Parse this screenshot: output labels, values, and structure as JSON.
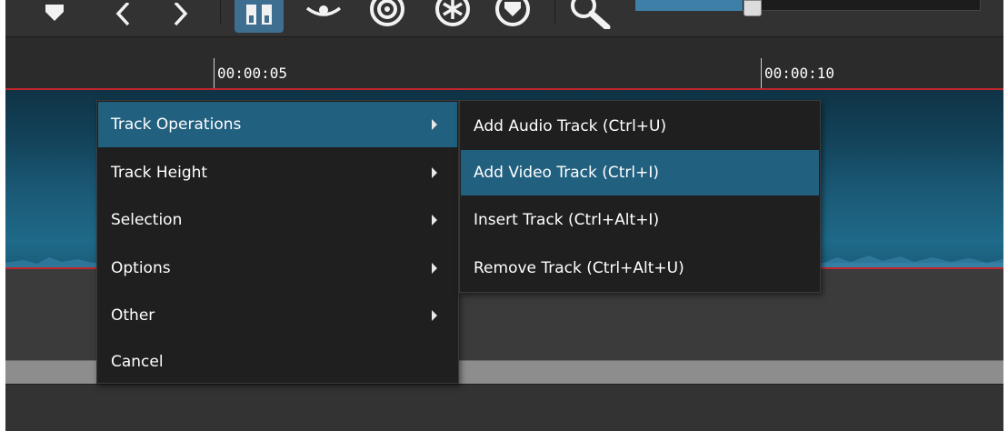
{
  "toolbar": {
    "icons": [
      "marker-icon",
      "previous-icon",
      "next-icon",
      "snap-icon",
      "scrub-icon",
      "ripple-icon",
      "ripple-all-icon",
      "ripple-markers-icon",
      "zoom-icon"
    ],
    "zoom_slider_value": 0.31
  },
  "ruler": {
    "ticks": [
      {
        "label": "00:00:05"
      },
      {
        "label": "00:00:10"
      }
    ]
  },
  "context_menu": {
    "items": [
      {
        "label": "Track Operations",
        "has_submenu": true,
        "active": true
      },
      {
        "label": "Track Height",
        "has_submenu": true
      },
      {
        "label": "Selection",
        "has_submenu": true
      },
      {
        "label": "Options",
        "has_submenu": true
      },
      {
        "label": "Other",
        "has_submenu": true
      },
      {
        "label": "Cancel",
        "has_submenu": false
      }
    ]
  },
  "submenu": {
    "items": [
      {
        "label": "Add Audio Track (Ctrl+U)"
      },
      {
        "label": "Add Video Track (Ctrl+I)",
        "active": true
      },
      {
        "label": "Insert Track (Ctrl+Alt+I)"
      },
      {
        "label": "Remove Track (Ctrl+Alt+U)"
      }
    ]
  },
  "colors": {
    "highlight": "#21607f",
    "playhead_red": "#c2262c",
    "track_blue": "#1e6a89"
  }
}
